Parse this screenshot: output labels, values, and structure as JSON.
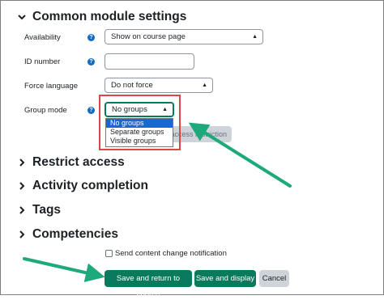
{
  "sections": {
    "common": {
      "title": "Common module settings"
    },
    "restrict": {
      "title": "Restrict access"
    },
    "completion": {
      "title": "Activity completion"
    },
    "tags": {
      "title": "Tags"
    },
    "competencies": {
      "title": "Competencies"
    }
  },
  "form": {
    "availability": {
      "label": "Availability",
      "value": "Show on course page"
    },
    "id_number": {
      "label": "ID number",
      "value": ""
    },
    "force_language": {
      "label": "Force language",
      "value": "Do not force"
    },
    "group_mode": {
      "label": "Group mode",
      "value": "No groups",
      "options": [
        "No groups",
        "Separate groups",
        "Visible groups"
      ]
    },
    "add_restriction_partial": "access restriction"
  },
  "notify": {
    "label": "Send content change notification"
  },
  "buttons": {
    "save_return": "Save and return to course",
    "save_display": "Save and display",
    "cancel": "Cancel"
  },
  "colors": {
    "primary": "#0a7a5c",
    "annotation_arrow": "#1ea97c",
    "annotation_box": "#e0444b",
    "help_icon": "#0f6cbf",
    "selected_option": "#1a66d2"
  }
}
